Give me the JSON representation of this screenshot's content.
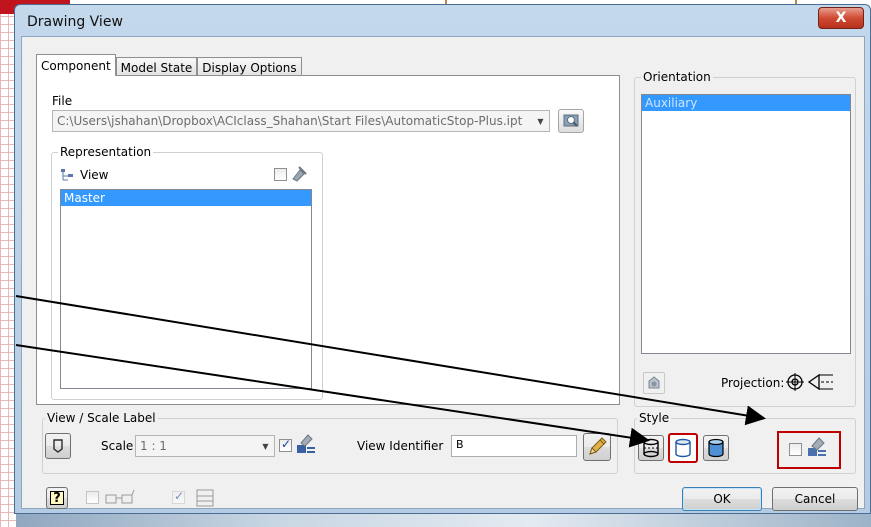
{
  "window": {
    "title": "Drawing View",
    "close_label": "X"
  },
  "tabs": [
    {
      "label": "Component"
    },
    {
      "label": "Model State"
    },
    {
      "label": "Display Options"
    }
  ],
  "file": {
    "label": "File",
    "path": "C:\\Users\\jshahan\\Dropbox\\ACIclass_Shahan\\Start Files\\AutomaticStop-Plus.ipt"
  },
  "representation": {
    "title": "Representation",
    "view_label": "View",
    "items": [
      "Master"
    ]
  },
  "orientation": {
    "title": "Orientation",
    "items": [
      "Auxiliary"
    ],
    "projection_label": "Projection:"
  },
  "view_scale": {
    "title": "View / Scale Label",
    "scale_label": "Scale",
    "scale_value": "1 : 1",
    "identifier_label": "View Identifier",
    "identifier_value": "B"
  },
  "style": {
    "title": "Style"
  },
  "buttons": {
    "ok": "OK",
    "cancel": "Cancel"
  },
  "colors": {
    "selection": "#3399ff",
    "highlight_box": "#c00000",
    "accent_red": "#c0141e"
  }
}
